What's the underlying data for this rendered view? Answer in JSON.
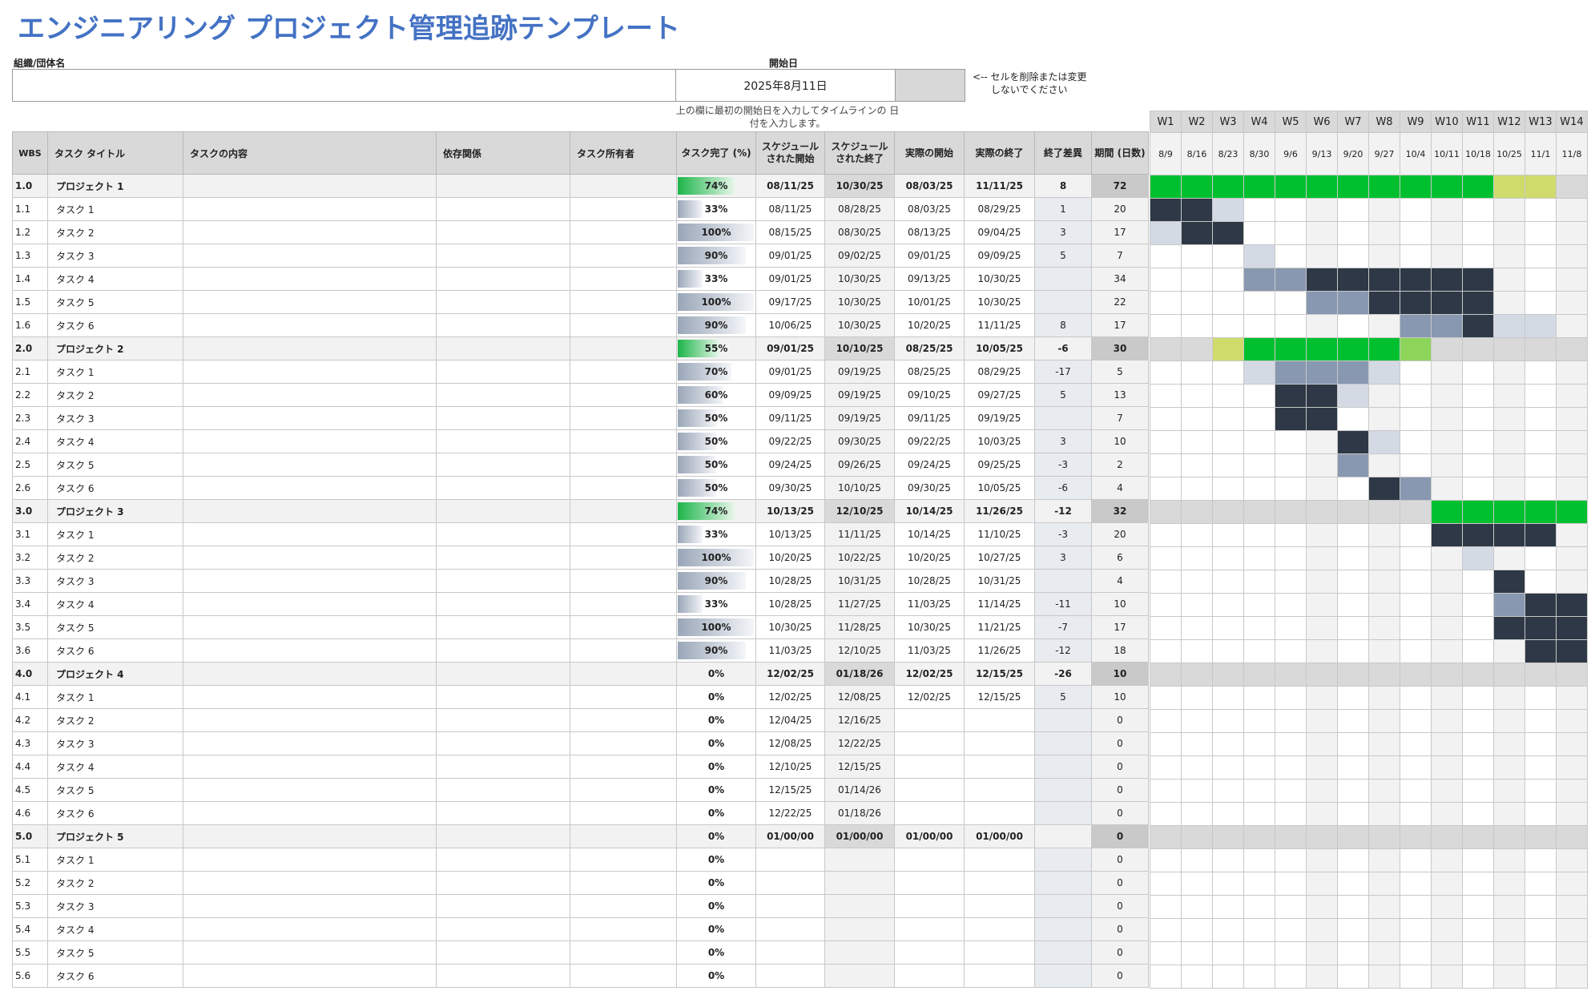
{
  "title": "エンジニアリング プロジェクト管理追跡テンプレート",
  "org_label": "組織/団体名",
  "start_label": "開始日",
  "start_date": "2025年8月11日",
  "note": "<-- セルを削除または変更\n      しないでください",
  "hint": "上の欄に最初の開始日を入力してタイムラインの\n日付を入力します。",
  "headers": {
    "wbs": "WBS",
    "title": "タスク タイトル",
    "desc": "タスクの内容",
    "dep": "依存関係",
    "owner": "タスク所有者",
    "pct": "タスク完了 (%)",
    "sstart": "スケジュール された開始",
    "send": "スケジュール された終了",
    "astart": "実際の開始",
    "aend": "実際の終了",
    "var": "終了差異",
    "dur": "期間 (日数)"
  },
  "weeks": [
    "W1",
    "W2",
    "W3",
    "W4",
    "W5",
    "W6",
    "W7",
    "W8",
    "W9",
    "W10",
    "W11",
    "W12",
    "W13",
    "W14"
  ],
  "week_dates": [
    "8/9",
    "8/16",
    "8/23",
    "8/30",
    "9/6",
    "9/13",
    "9/20",
    "9/27",
    "10/4",
    "10/11",
    "10/18",
    "10/25",
    "11/1",
    "11/8"
  ],
  "rows": [
    {
      "wbs": "1.0",
      "title": "プロジェクト 1",
      "pct": "74%",
      "p": 74,
      "ss": "08/11/25",
      "se": "10/30/25",
      "as": "08/03/25",
      "ae": "11/11/25",
      "var": "8",
      "dur": "72",
      "proj": true
    },
    {
      "wbs": "1.1",
      "title": "タスク 1",
      "pct": "33%",
      "p": 33,
      "ss": "08/11/25",
      "se": "08/28/25",
      "as": "08/03/25",
      "ae": "08/29/25",
      "var": "1",
      "dur": "20"
    },
    {
      "wbs": "1.2",
      "title": "タスク 2",
      "pct": "100%",
      "p": 100,
      "ss": "08/15/25",
      "se": "08/30/25",
      "as": "08/13/25",
      "ae": "09/04/25",
      "var": "3",
      "dur": "17"
    },
    {
      "wbs": "1.3",
      "title": "タスク 3",
      "pct": "90%",
      "p": 90,
      "ss": "09/01/25",
      "se": "09/02/25",
      "as": "09/01/25",
      "ae": "09/09/25",
      "var": "5",
      "dur": "7"
    },
    {
      "wbs": "1.4",
      "title": "タスク 4",
      "pct": "33%",
      "p": 33,
      "ss": "09/01/25",
      "se": "10/30/25",
      "as": "09/13/25",
      "ae": "10/30/25",
      "var": "",
      "dur": "34"
    },
    {
      "wbs": "1.5",
      "title": "タスク 5",
      "pct": "100%",
      "p": 100,
      "ss": "09/17/25",
      "se": "10/30/25",
      "as": "10/01/25",
      "ae": "10/30/25",
      "var": "",
      "dur": "22"
    },
    {
      "wbs": "1.6",
      "title": "タスク 6",
      "pct": "90%",
      "p": 90,
      "ss": "10/06/25",
      "se": "10/30/25",
      "as": "10/20/25",
      "ae": "11/11/25",
      "var": "8",
      "dur": "17"
    },
    {
      "wbs": "2.0",
      "title": "プロジェクト 2",
      "pct": "55%",
      "p": 55,
      "ss": "09/01/25",
      "se": "10/10/25",
      "as": "08/25/25",
      "ae": "10/05/25",
      "var": "-6",
      "dur": "30",
      "proj": true
    },
    {
      "wbs": "2.1",
      "title": "タスク 1",
      "pct": "70%",
      "p": 70,
      "ss": "09/01/25",
      "se": "09/19/25",
      "as": "08/25/25",
      "ae": "08/29/25",
      "var": "-17",
      "dur": "5"
    },
    {
      "wbs": "2.2",
      "title": "タスク 2",
      "pct": "60%",
      "p": 60,
      "ss": "09/09/25",
      "se": "09/19/25",
      "as": "09/10/25",
      "ae": "09/27/25",
      "var": "5",
      "dur": "13"
    },
    {
      "wbs": "2.3",
      "title": "タスク 3",
      "pct": "50%",
      "p": 50,
      "ss": "09/11/25",
      "se": "09/19/25",
      "as": "09/11/25",
      "ae": "09/19/25",
      "var": "",
      "dur": "7"
    },
    {
      "wbs": "2.4",
      "title": "タスク 4",
      "pct": "50%",
      "p": 50,
      "ss": "09/22/25",
      "se": "09/30/25",
      "as": "09/22/25",
      "ae": "10/03/25",
      "var": "3",
      "dur": "10"
    },
    {
      "wbs": "2.5",
      "title": "タスク 5",
      "pct": "50%",
      "p": 50,
      "ss": "09/24/25",
      "se": "09/26/25",
      "as": "09/24/25",
      "ae": "09/25/25",
      "var": "-3",
      "dur": "2"
    },
    {
      "wbs": "2.6",
      "title": "タスク 6",
      "pct": "50%",
      "p": 50,
      "ss": "09/30/25",
      "se": "10/10/25",
      "as": "09/30/25",
      "ae": "10/05/25",
      "var": "-6",
      "dur": "4"
    },
    {
      "wbs": "3.0",
      "title": "プロジェクト 3",
      "pct": "74%",
      "p": 74,
      "ss": "10/13/25",
      "se": "12/10/25",
      "as": "10/14/25",
      "ae": "11/26/25",
      "var": "-12",
      "dur": "32",
      "proj": true
    },
    {
      "wbs": "3.1",
      "title": "タスク 1",
      "pct": "33%",
      "p": 33,
      "ss": "10/13/25",
      "se": "11/11/25",
      "as": "10/14/25",
      "ae": "11/10/25",
      "var": "-3",
      "dur": "20"
    },
    {
      "wbs": "3.2",
      "title": "タスク 2",
      "pct": "100%",
      "p": 100,
      "ss": "10/20/25",
      "se": "10/22/25",
      "as": "10/20/25",
      "ae": "10/27/25",
      "var": "3",
      "dur": "6"
    },
    {
      "wbs": "3.3",
      "title": "タスク 3",
      "pct": "90%",
      "p": 90,
      "ss": "10/28/25",
      "se": "10/31/25",
      "as": "10/28/25",
      "ae": "10/31/25",
      "var": "",
      "dur": "4"
    },
    {
      "wbs": "3.4",
      "title": "タスク 4",
      "pct": "33%",
      "p": 33,
      "ss": "10/28/25",
      "se": "11/27/25",
      "as": "11/03/25",
      "ae": "11/14/25",
      "var": "-11",
      "dur": "10"
    },
    {
      "wbs": "3.5",
      "title": "タスク 5",
      "pct": "100%",
      "p": 100,
      "ss": "10/30/25",
      "se": "11/28/25",
      "as": "10/30/25",
      "ae": "11/21/25",
      "var": "-7",
      "dur": "17"
    },
    {
      "wbs": "3.6",
      "title": "タスク 6",
      "pct": "90%",
      "p": 90,
      "ss": "11/03/25",
      "se": "12/10/25",
      "as": "11/03/25",
      "ae": "11/26/25",
      "var": "-12",
      "dur": "18"
    },
    {
      "wbs": "4.0",
      "title": "プロジェクト 4",
      "pct": "0%",
      "p": 0,
      "ss": "12/02/25",
      "se": "01/18/26",
      "as": "12/02/25",
      "ae": "12/15/25",
      "var": "-26",
      "dur": "10",
      "proj": true
    },
    {
      "wbs": "4.1",
      "title": "タスク 1",
      "pct": "0%",
      "p": 0,
      "ss": "12/02/25",
      "se": "12/08/25",
      "as": "12/02/25",
      "ae": "12/15/25",
      "var": "5",
      "dur": "10"
    },
    {
      "wbs": "4.2",
      "title": "タスク 2",
      "pct": "0%",
      "p": 0,
      "ss": "12/04/25",
      "se": "12/16/25",
      "as": "",
      "ae": "",
      "var": "",
      "dur": "0"
    },
    {
      "wbs": "4.3",
      "title": "タスク 3",
      "pct": "0%",
      "p": 0,
      "ss": "12/08/25",
      "se": "12/22/25",
      "as": "",
      "ae": "",
      "var": "",
      "dur": "0"
    },
    {
      "wbs": "4.4",
      "title": "タスク 4",
      "pct": "0%",
      "p": 0,
      "ss": "12/10/25",
      "se": "12/15/25",
      "as": "",
      "ae": "",
      "var": "",
      "dur": "0"
    },
    {
      "wbs": "4.5",
      "title": "タスク 5",
      "pct": "0%",
      "p": 0,
      "ss": "12/15/25",
      "se": "01/14/26",
      "as": "",
      "ae": "",
      "var": "",
      "dur": "0"
    },
    {
      "wbs": "4.6",
      "title": "タスク 6",
      "pct": "0%",
      "p": 0,
      "ss": "12/22/25",
      "se": "01/18/26",
      "as": "",
      "ae": "",
      "var": "",
      "dur": "0"
    },
    {
      "wbs": "5.0",
      "title": "プロジェクト 5",
      "pct": "0%",
      "p": 0,
      "ss": "01/00/00",
      "se": "01/00/00",
      "as": "01/00/00",
      "ae": "01/00/00",
      "var": "",
      "dur": "0",
      "proj": true
    },
    {
      "wbs": "5.1",
      "title": "タスク 1",
      "pct": "0%",
      "p": 0,
      "ss": "",
      "se": "",
      "as": "",
      "ae": "",
      "var": "",
      "dur": "0"
    },
    {
      "wbs": "5.2",
      "title": "タスク 2",
      "pct": "0%",
      "p": 0,
      "ss": "",
      "se": "",
      "as": "",
      "ae": "",
      "var": "",
      "dur": "0"
    },
    {
      "wbs": "5.3",
      "title": "タスク 3",
      "pct": "0%",
      "p": 0,
      "ss": "",
      "se": "",
      "as": "",
      "ae": "",
      "var": "",
      "dur": "0"
    },
    {
      "wbs": "5.4",
      "title": "タスク 4",
      "pct": "0%",
      "p": 0,
      "ss": "",
      "se": "",
      "as": "",
      "ae": "",
      "var": "",
      "dur": "0"
    },
    {
      "wbs": "5.5",
      "title": "タスク 5",
      "pct": "0%",
      "p": 0,
      "ss": "",
      "se": "",
      "as": "",
      "ae": "",
      "var": "",
      "dur": "0"
    },
    {
      "wbs": "5.6",
      "title": "タスク 6",
      "pct": "0%",
      "p": 0,
      "ss": "",
      "se": "",
      "as": "",
      "ae": "",
      "var": "",
      "dur": "0"
    }
  ],
  "gantt": [
    "GGGGGGGGGGGLL.",
    "DDl...........",
    "lDD...........",
    "...l..........",
    "...MMDDDDDD...",
    ".....MMDDDD...",
    "........MMDll.",
    "..LGGGGGg.....",
    "...lMMMl......",
    "....DDl.......",
    "....DD........",
    "......Dl......",
    "......M.......",
    ".......DM.....",
    ".........GGGGG",
    ".........DDDD.",
    "..........l...",
    "...........D..",
    "...........MDD",
    "...........DDD",
    "............DD",
    "..............",
    "..............",
    "..............",
    "..............",
    "..............",
    "..............",
    "..............",
    "..............",
    "..............",
    "..............",
    "..............",
    "..............",
    "..............",
    ".............."
  ],
  "colors": {
    "title": "#4472c4",
    "bar_green": "#00c030",
    "bar_dark": "#2e3846",
    "bar_mid": "#8898b0",
    "bar_light": "#d3dae4",
    "bar_lime": "#cfdc6c"
  }
}
